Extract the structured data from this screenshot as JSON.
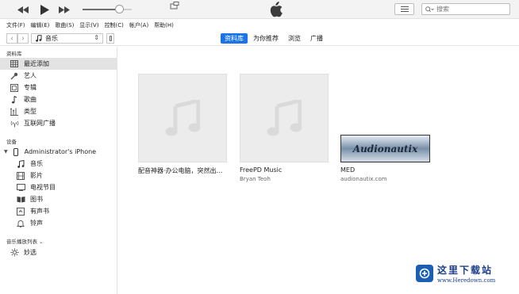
{
  "player": {
    "volume": 0.74
  },
  "search": {
    "placeholder": "搜索"
  },
  "menu": [
    "文件(F)",
    "编辑(E)",
    "歌曲(S)",
    "显示(V)",
    "控制(C)",
    "帐户(A)",
    "帮助(H)"
  ],
  "nav": {
    "media_label": "音乐",
    "tabs": [
      "资料库",
      "为你推荐",
      "浏览",
      "广播"
    ],
    "active_tab": 0
  },
  "sidebar": {
    "library_header": "资料库",
    "library_items": [
      {
        "label": "最近添加",
        "icon": "grid-icon",
        "selected": true
      },
      {
        "label": "艺人",
        "icon": "microphone-icon"
      },
      {
        "label": "专辑",
        "icon": "album-icon"
      },
      {
        "label": "歌曲",
        "icon": "note-icon"
      },
      {
        "label": "类型",
        "icon": "genre-icon"
      },
      {
        "label": "互联网广播",
        "icon": "radio-icon"
      }
    ],
    "devices_header": "设备",
    "device_name": "Administrator's iPhone",
    "device_items": [
      {
        "label": "音乐",
        "icon": "music-note-icon"
      },
      {
        "label": "影片",
        "icon": "film-icon"
      },
      {
        "label": "电视节目",
        "icon": "tv-icon"
      },
      {
        "label": "图书",
        "icon": "book-icon"
      },
      {
        "label": "有声书",
        "icon": "audiobook-icon"
      },
      {
        "label": "铃声",
        "icon": "bell-icon"
      }
    ],
    "playlists_header": "音乐播放列表",
    "playlist_items": [
      {
        "label": "妙选",
        "icon": "genius-icon"
      }
    ]
  },
  "albums": [
    {
      "title": "配音神器·办公电脑，突然出…",
      "artist": ""
    },
    {
      "title": "FreePD Music",
      "artist": "Bryan Teoh"
    },
    {
      "title": "MED",
      "artist": "audionautix.com",
      "cover_text": "Audionautix"
    }
  ],
  "watermark": {
    "title": "这里下载站",
    "url": "www.Heredown.com"
  }
}
